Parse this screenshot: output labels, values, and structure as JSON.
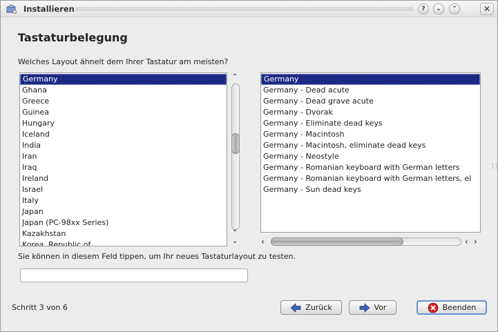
{
  "window": {
    "title": "Installieren",
    "buttons": {
      "help": "?",
      "minimize": "⌄",
      "maximize": "⌃",
      "close": "✕"
    }
  },
  "page": {
    "heading": "Tastaturbelegung",
    "question": "Welches Layout ähnelt dem Ihrer Tastatur am meisten?"
  },
  "countries": {
    "selected": "Germany",
    "items": [
      "Germany",
      "Ghana",
      "Greece",
      "Guinea",
      "Hungary",
      "Iceland",
      "India",
      "Iran",
      "Iraq",
      "Ireland",
      "Israel",
      "Italy",
      "Japan",
      "Japan (PC-98xx Series)",
      "Kazakhstan",
      "Korea, Republic of"
    ]
  },
  "variants": {
    "selected": "Germany",
    "items": [
      "Germany",
      "Germany - Dead acute",
      "Germany - Dead grave acute",
      "Germany - Dvorak",
      "Germany - Eliminate dead keys",
      "Germany - Macintosh",
      "Germany - Macintosh, eliminate dead keys",
      "Germany - Neostyle",
      "Germany - Romanian keyboard with German letters",
      "Germany - Romanian keyboard with German letters, el",
      "Germany - Sun dead keys"
    ]
  },
  "test": {
    "hint": "Sie können in diesem Feld tippen, um Ihr neues Tastaturlayout zu testen.",
    "value": ""
  },
  "footer": {
    "step": "Schritt 3 von 6",
    "back_label": "Zurück",
    "next_label": "Vor",
    "quit_label": "Beenden"
  },
  "colors": {
    "selection": "#1d2a84",
    "quit_icon": "#d42020",
    "arrow_icon": "#3a62b4"
  }
}
